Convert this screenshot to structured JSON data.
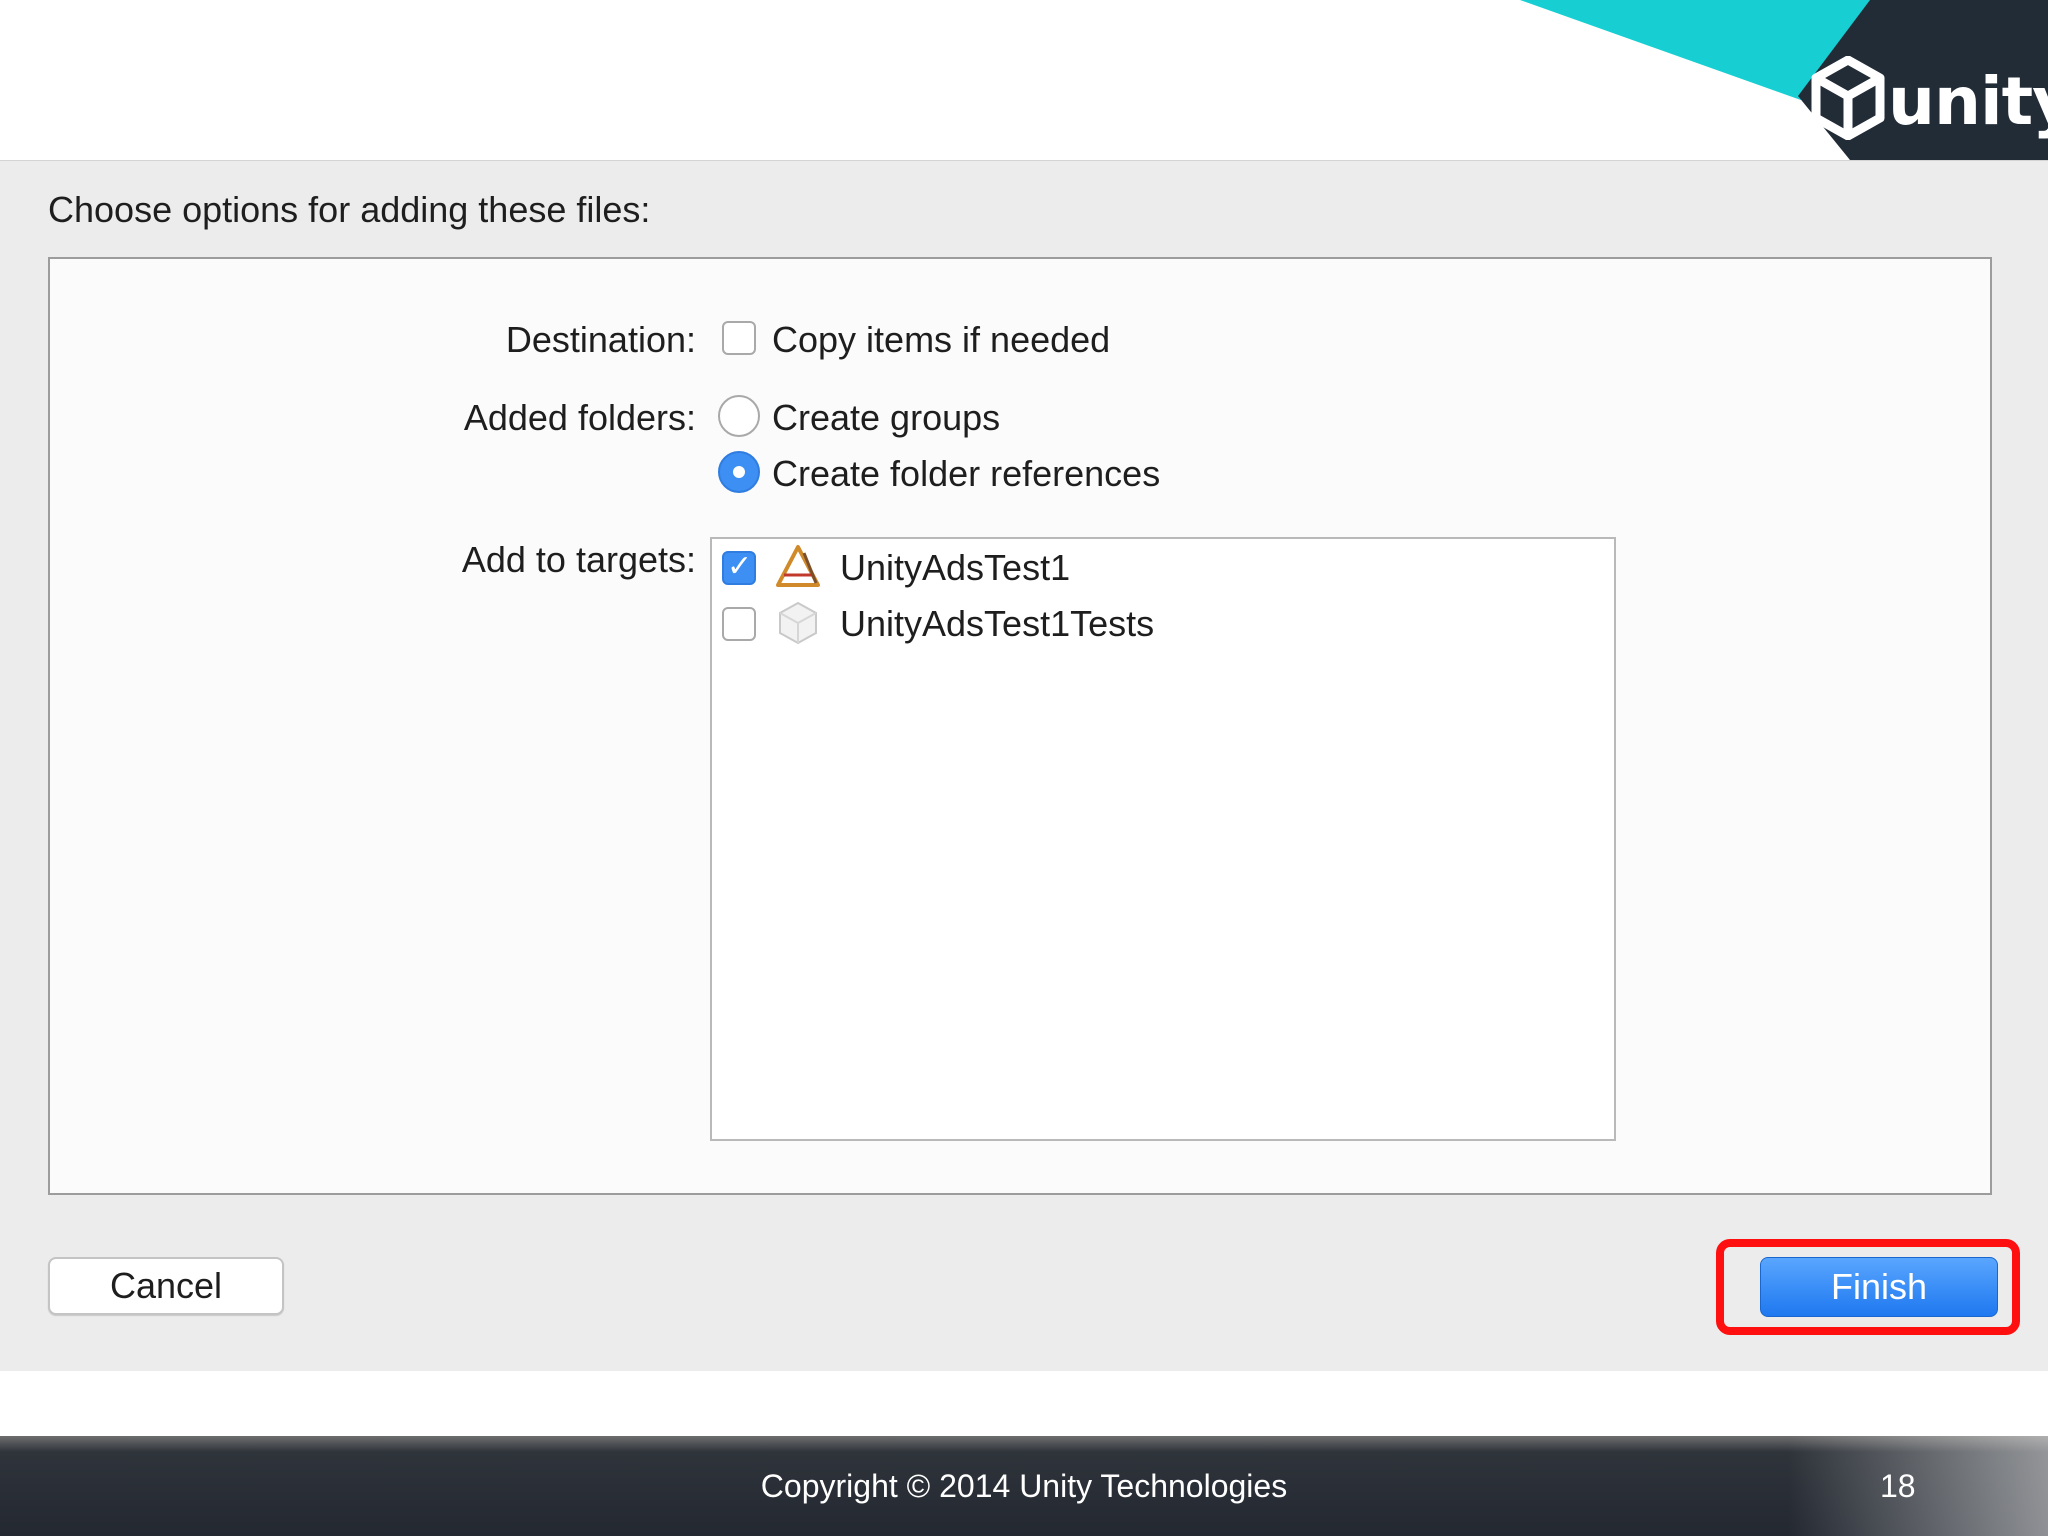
{
  "header": {
    "logo_text": "unity"
  },
  "dialog": {
    "heading": "Choose options for adding these files:",
    "destination": {
      "label": "Destination:",
      "option_label": "Copy items if needed",
      "checked": false
    },
    "added_folders": {
      "label": "Added folders:",
      "options": [
        {
          "label": "Create groups",
          "selected": false
        },
        {
          "label": "Create folder references",
          "selected": true
        }
      ]
    },
    "add_to_targets": {
      "label": "Add to targets:",
      "targets": [
        {
          "name": "UnityAdsTest1",
          "checked": true,
          "icon": "app-target-icon"
        },
        {
          "name": "UnityAdsTest1Tests",
          "checked": false,
          "icon": "test-bundle-icon"
        }
      ]
    },
    "buttons": {
      "cancel": "Cancel",
      "finish": "Finish"
    }
  },
  "footer": {
    "copyright": "Copyright © 2014 Unity Technologies",
    "page_number": "18"
  },
  "colors": {
    "accent_blue": "#3d8ff3",
    "highlight_red": "#ff1010",
    "teal": "#17cfd3",
    "logo_bg": "#222c37"
  }
}
